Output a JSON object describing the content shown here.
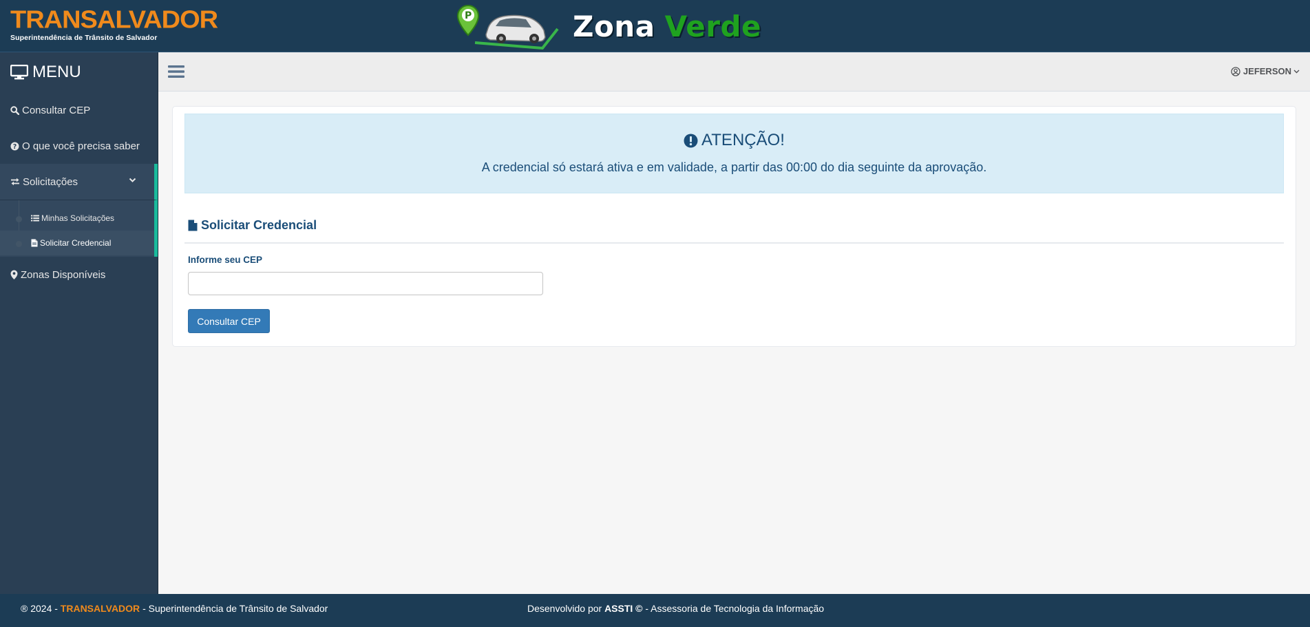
{
  "header": {
    "brand_name": "TRANSALVADOR",
    "brand_sub": "Superintendência de Trânsito de Salvador",
    "logo_word1": "Zona",
    "logo_word2": "Verde",
    "brand_color": "#f08a1c",
    "header_bg": "#1c3c55"
  },
  "sidebar": {
    "menu_title": "MENU",
    "items": [
      {
        "label": "Consultar CEP",
        "icon": "search-icon"
      },
      {
        "label": "O que você precisa saber",
        "icon": "question-circle-icon"
      },
      {
        "label": "Solicitações",
        "icon": "exchange-icon",
        "expanded": true,
        "children": [
          {
            "label": "Minhas Solicitações",
            "icon": "list-icon"
          },
          {
            "label": "Solicitar Credencial",
            "icon": "file-icon",
            "current": true
          }
        ]
      },
      {
        "label": "Zonas Disponíveis",
        "icon": "map-marker-icon"
      }
    ],
    "accent_color": "#1abb9c"
  },
  "topnav": {
    "user_name": "JEFERSON"
  },
  "alert": {
    "title": "ATENÇÃO!",
    "message": "A credencial só estará ativa e em validade, a partir das 00:00 do dia seguinte da aprovação."
  },
  "form": {
    "section_title": "Solicitar Credencial",
    "cep_label": "Informe seu CEP",
    "cep_value": "",
    "cep_placeholder": "",
    "submit_label": "Consultar CEP"
  },
  "footer": {
    "copyright_prefix": "® 2024 -",
    "org_name": "TRANSALVADOR",
    "org_suffix": "- Superintendência de Trânsito de Salvador",
    "dev_prefix": "Desenvolvido por",
    "dev_name": "ASSTI ©",
    "dev_suffix": "- Assessoria de Tecnologia da Informação"
  }
}
